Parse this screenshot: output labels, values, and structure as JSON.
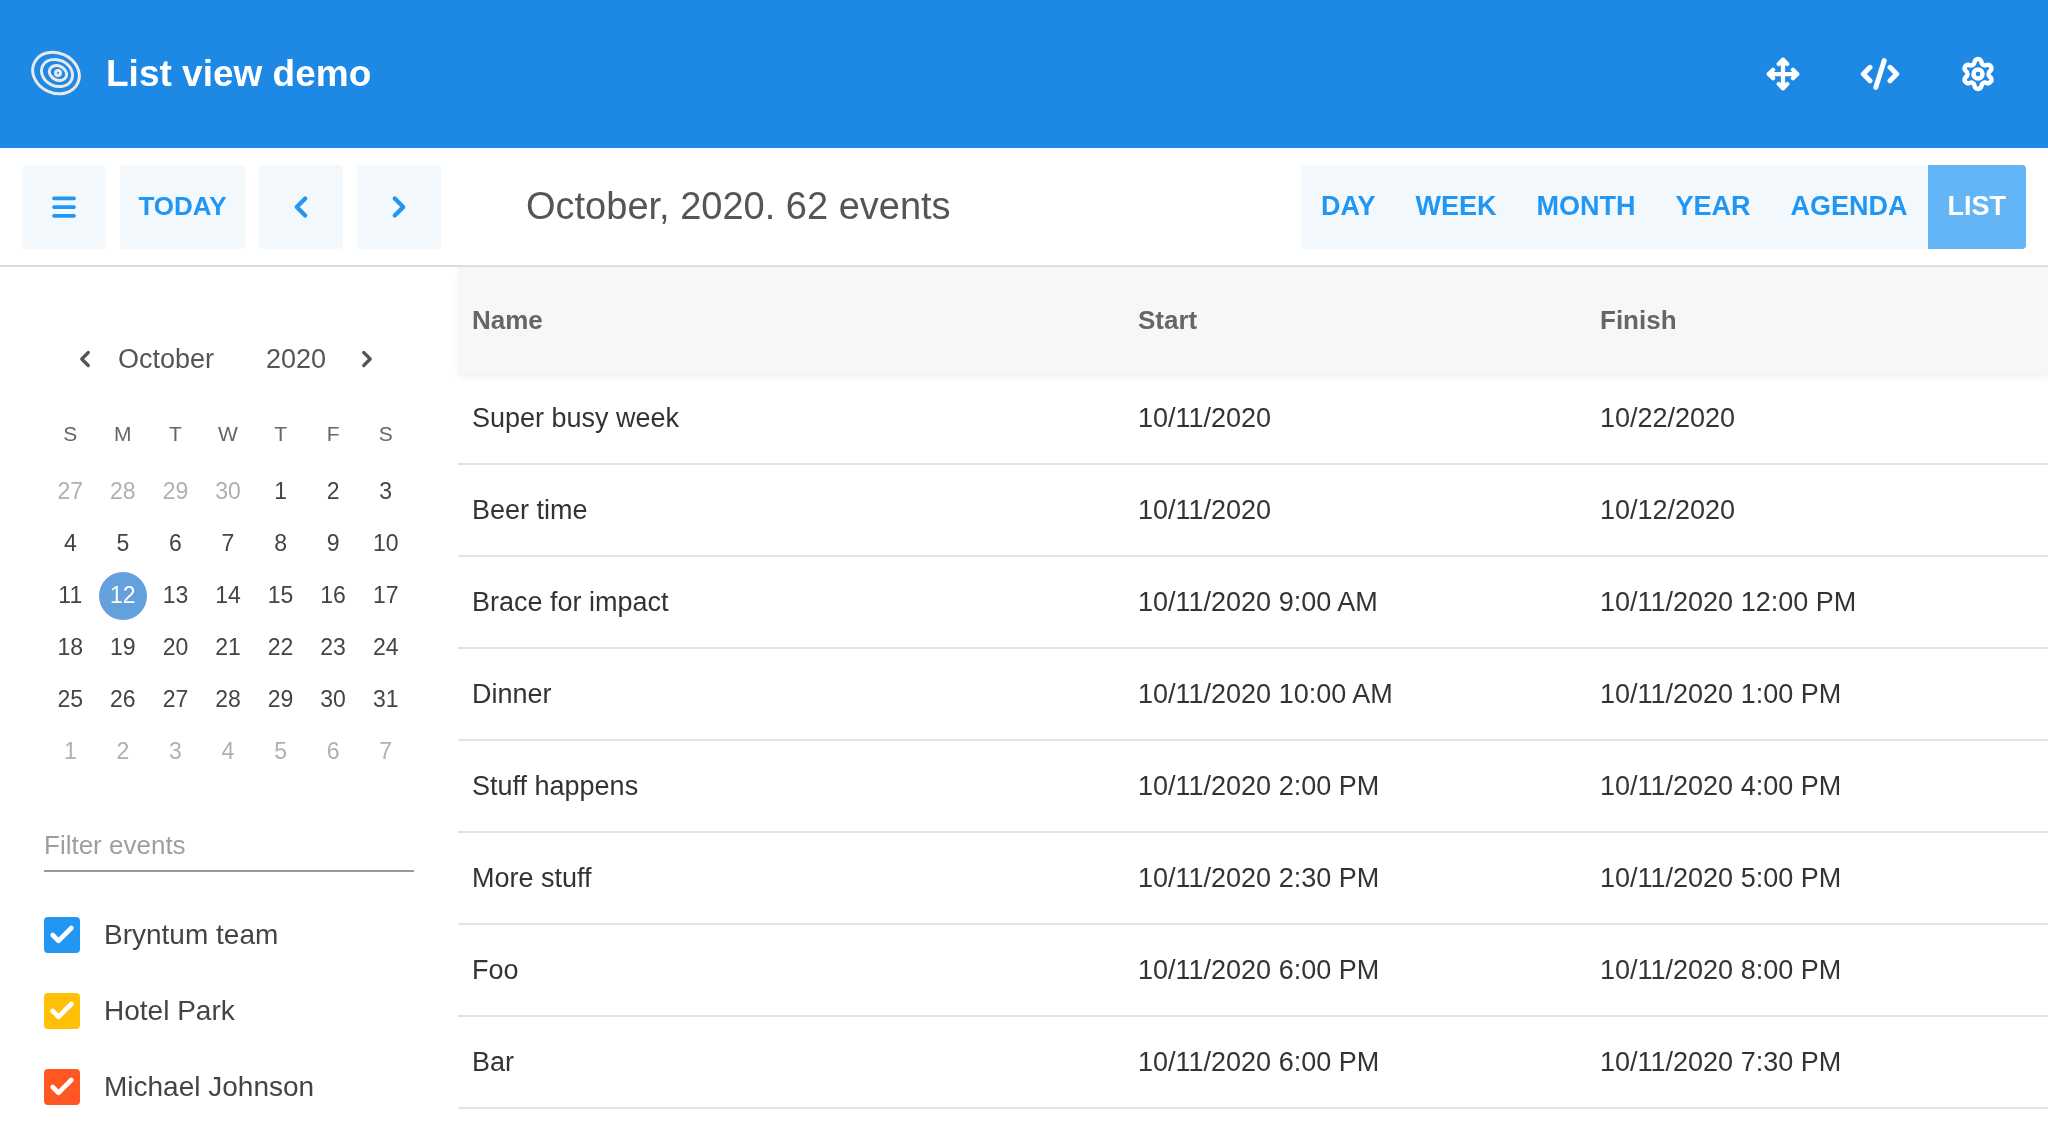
{
  "header": {
    "title": "List view demo"
  },
  "toolbar": {
    "today": "TODAY",
    "title": "October, 2020. 62 events",
    "views": [
      {
        "label": "DAY",
        "selected": false
      },
      {
        "label": "WEEK",
        "selected": false
      },
      {
        "label": "MONTH",
        "selected": false
      },
      {
        "label": "YEAR",
        "selected": false
      },
      {
        "label": "AGENDA",
        "selected": false
      },
      {
        "label": "LIST",
        "selected": true
      }
    ]
  },
  "mini_calendar": {
    "month": "October",
    "year": "2020",
    "weekdays": [
      "S",
      "M",
      "T",
      "W",
      "T",
      "F",
      "S"
    ],
    "weeks": [
      [
        {
          "day": "27",
          "outside": true,
          "selected": false
        },
        {
          "day": "28",
          "outside": true,
          "selected": false
        },
        {
          "day": "29",
          "outside": true,
          "selected": false
        },
        {
          "day": "30",
          "outside": true,
          "selected": false
        },
        {
          "day": "1",
          "outside": false,
          "selected": false
        },
        {
          "day": "2",
          "outside": false,
          "selected": false
        },
        {
          "day": "3",
          "outside": false,
          "selected": false
        }
      ],
      [
        {
          "day": "4",
          "outside": false,
          "selected": false
        },
        {
          "day": "5",
          "outside": false,
          "selected": false
        },
        {
          "day": "6",
          "outside": false,
          "selected": false
        },
        {
          "day": "7",
          "outside": false,
          "selected": false
        },
        {
          "day": "8",
          "outside": false,
          "selected": false
        },
        {
          "day": "9",
          "outside": false,
          "selected": false
        },
        {
          "day": "10",
          "outside": false,
          "selected": false
        }
      ],
      [
        {
          "day": "11",
          "outside": false,
          "selected": false
        },
        {
          "day": "12",
          "outside": false,
          "selected": true
        },
        {
          "day": "13",
          "outside": false,
          "selected": false
        },
        {
          "day": "14",
          "outside": false,
          "selected": false
        },
        {
          "day": "15",
          "outside": false,
          "selected": false
        },
        {
          "day": "16",
          "outside": false,
          "selected": false
        },
        {
          "day": "17",
          "outside": false,
          "selected": false
        }
      ],
      [
        {
          "day": "18",
          "outside": false,
          "selected": false
        },
        {
          "day": "19",
          "outside": false,
          "selected": false
        },
        {
          "day": "20",
          "outside": false,
          "selected": false
        },
        {
          "day": "21",
          "outside": false,
          "selected": false
        },
        {
          "day": "22",
          "outside": false,
          "selected": false
        },
        {
          "day": "23",
          "outside": false,
          "selected": false
        },
        {
          "day": "24",
          "outside": false,
          "selected": false
        }
      ],
      [
        {
          "day": "25",
          "outside": false,
          "selected": false
        },
        {
          "day": "26",
          "outside": false,
          "selected": false
        },
        {
          "day": "27",
          "outside": false,
          "selected": false
        },
        {
          "day": "28",
          "outside": false,
          "selected": false
        },
        {
          "day": "29",
          "outside": false,
          "selected": false
        },
        {
          "day": "30",
          "outside": false,
          "selected": false
        },
        {
          "day": "31",
          "outside": false,
          "selected": false
        }
      ],
      [
        {
          "day": "1",
          "outside": true,
          "selected": false
        },
        {
          "day": "2",
          "outside": true,
          "selected": false
        },
        {
          "day": "3",
          "outside": true,
          "selected": false
        },
        {
          "day": "4",
          "outside": true,
          "selected": false
        },
        {
          "day": "5",
          "outside": true,
          "selected": false
        },
        {
          "day": "6",
          "outside": true,
          "selected": false
        },
        {
          "day": "7",
          "outside": true,
          "selected": false
        }
      ]
    ]
  },
  "filter": {
    "placeholder": "Filter events"
  },
  "resources": [
    {
      "name": "Bryntum team",
      "checked": true,
      "color": "#2196f3"
    },
    {
      "name": "Hotel Park",
      "checked": true,
      "color": "#ffc107"
    },
    {
      "name": "Michael Johnson",
      "checked": true,
      "color": "#ff5722"
    }
  ],
  "table": {
    "columns": [
      "Name",
      "Start",
      "Finish"
    ],
    "rows": [
      [
        "Super busy week",
        "10/11/2020",
        "10/22/2020"
      ],
      [
        "Beer time",
        "10/11/2020",
        "10/12/2020"
      ],
      [
        "Brace for impact",
        "10/11/2020 9:00 AM",
        "10/11/2020 12:00 PM"
      ],
      [
        "Dinner",
        "10/11/2020 10:00 AM",
        "10/11/2020 1:00 PM"
      ],
      [
        "Stuff happens",
        "10/11/2020 2:00 PM",
        "10/11/2020 4:00 PM"
      ],
      [
        "More stuff",
        "10/11/2020 2:30 PM",
        "10/11/2020 5:00 PM"
      ],
      [
        "Foo",
        "10/11/2020 6:00 PM",
        "10/11/2020 8:00 PM"
      ],
      [
        "Bar",
        "10/11/2020 6:00 PM",
        "10/11/2020 7:30 PM"
      ]
    ]
  }
}
